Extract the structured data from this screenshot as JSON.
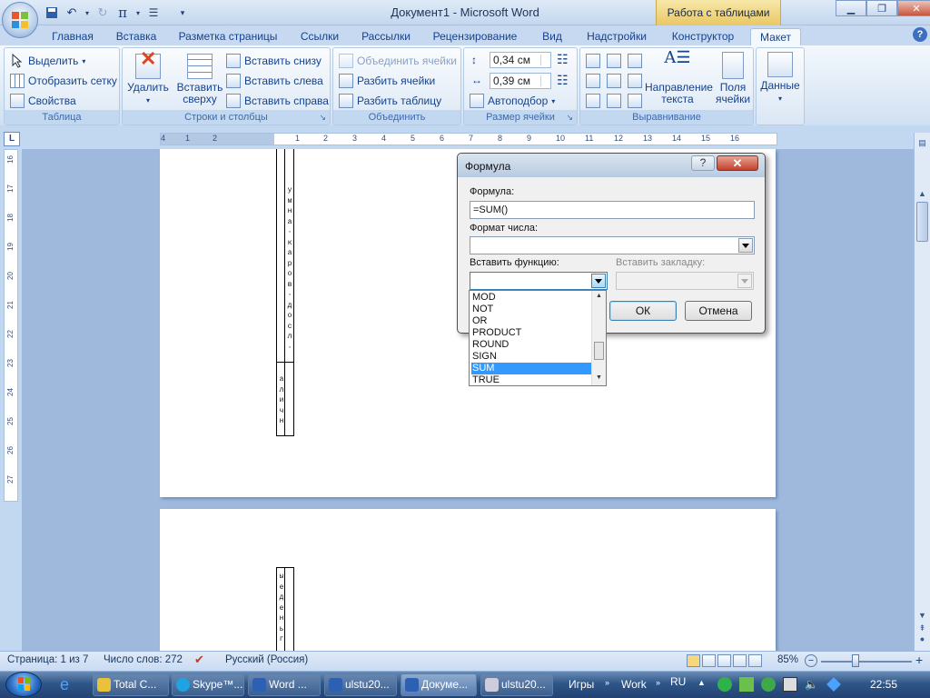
{
  "title_bar": {
    "document_title": "Документ1 - Microsoft Word",
    "context_tab_title": "Работа с таблицами"
  },
  "tabs": [
    {
      "label": "Главная",
      "active": false
    },
    {
      "label": "Вставка",
      "active": false
    },
    {
      "label": "Разметка страницы",
      "active": false
    },
    {
      "label": "Ссылки",
      "active": false
    },
    {
      "label": "Рассылки",
      "active": false
    },
    {
      "label": "Рецензирование",
      "active": false
    },
    {
      "label": "Вид",
      "active": false
    },
    {
      "label": "Надстройки",
      "active": false
    },
    {
      "label": "Конструктор",
      "active": false
    },
    {
      "label": "Макет",
      "active": true
    }
  ],
  "ribbon": {
    "table_group": {
      "label": "Таблица",
      "select": "Выделить",
      "show_grid": "Отобразить сетку",
      "properties": "Свойства"
    },
    "rows_cols_group": {
      "label": "Строки и столбцы",
      "delete": "Удалить",
      "insert_above": "Вставить сверху",
      "insert_below": "Вставить снизу",
      "insert_left": "Вставить слева",
      "insert_right": "Вставить справа"
    },
    "merge_group": {
      "label": "Объединить",
      "merge_cells": "Объединить ячейки",
      "split_cells": "Разбить ячейки",
      "split_table": "Разбить таблицу"
    },
    "cell_size_group": {
      "label": "Размер ячейки",
      "height": "0,34 см",
      "width": "0,39 см",
      "autofit": "Автоподбор"
    },
    "alignment_group": {
      "label": "Выравнивание",
      "text_direction": "Направление текста",
      "cell_margins": "Поля ячейки"
    },
    "data_group": {
      "label": "Данные"
    }
  },
  "ruler": {
    "horizontal_ticks": [
      "4",
      "1",
      "2",
      "1",
      "2",
      "3",
      "4",
      "5",
      "6",
      "7",
      "8",
      "9",
      "10",
      "11",
      "12",
      "13",
      "14",
      "15",
      "16"
    ],
    "vertical_ticks": [
      "16",
      "17",
      "18",
      "19",
      "20",
      "21",
      "22",
      "23",
      "24",
      "25",
      "26",
      "27"
    ]
  },
  "document": {
    "page1_cell_upper_text": "умна·каров·досл·",
    "page1_cell_lower_text": "аличн",
    "page2_cell_text": "ыеденьг"
  },
  "dialog": {
    "title": "Формула",
    "help_label": "?",
    "close_label": "✕",
    "formula_label": "Формула:",
    "formula_value": "=SUM()",
    "number_format_label": "Формат числа:",
    "number_format_value": "",
    "insert_function_label": "Вставить функцию:",
    "insert_bookmark_label": "Вставить закладку:",
    "ok_label": "ОК",
    "cancel_label": "Отмена",
    "function_list": [
      "MOD",
      "NOT",
      "OR",
      "PRODUCT",
      "ROUND",
      "SIGN",
      "SUM",
      "TRUE"
    ],
    "selected_function": "SUM"
  },
  "status_bar": {
    "page": "Страница: 1 из 7",
    "word_count": "Число слов: 272",
    "language": "Русский (Россия)",
    "zoom": "85%"
  },
  "taskbar": {
    "items": [
      {
        "label": "Total C...",
        "active": false
      },
      {
        "label": "Skype™...",
        "active": false
      },
      {
        "label": "Word ...",
        "active": false
      },
      {
        "label": "ulstu20...",
        "active": false
      },
      {
        "label": "Докуме...",
        "active": true
      },
      {
        "label": "ulstu20...",
        "active": false
      }
    ],
    "toolbar_games": "Игры",
    "toolbar_work": "Work",
    "language": "RU",
    "clock": "22:55"
  },
  "colors": {
    "ribbon_text": "#15428b",
    "context_tab": "#e9c865",
    "selection": "#3399ff",
    "doc_background": "#9fb9dd"
  }
}
